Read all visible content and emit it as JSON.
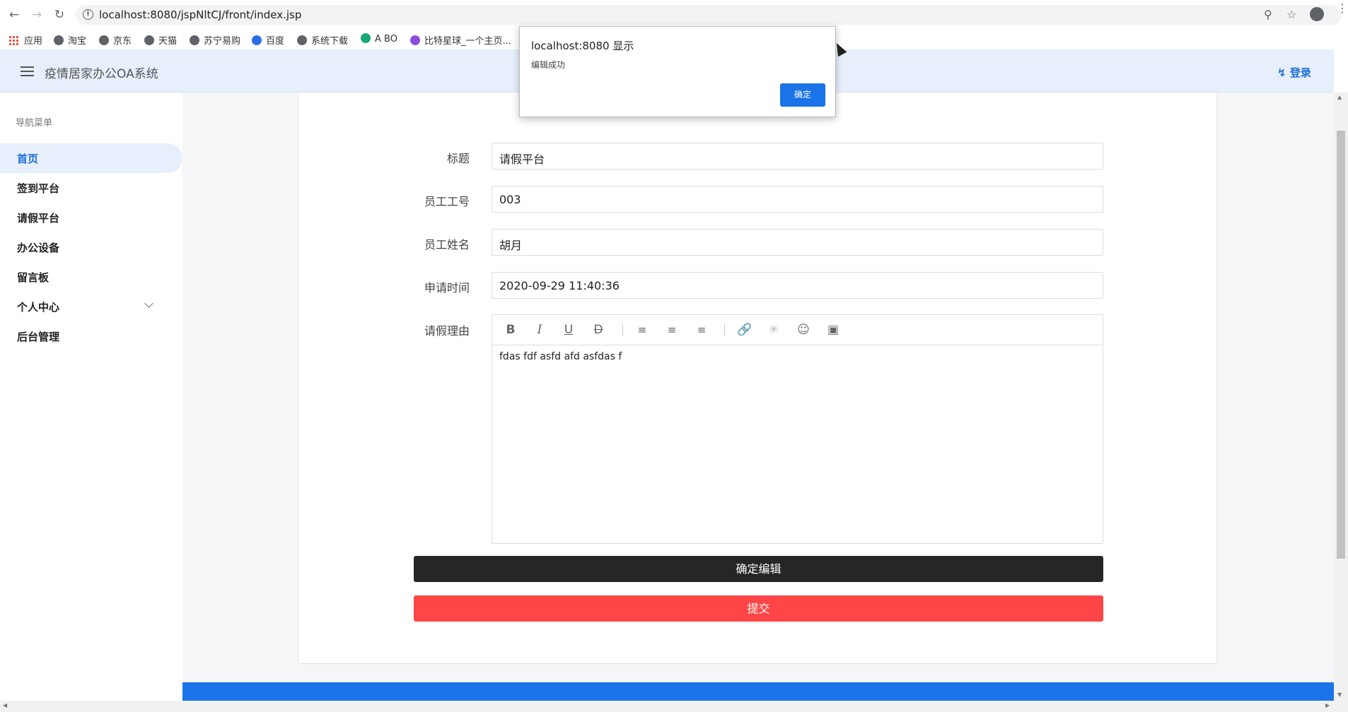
{
  "browser": {
    "url": "localhost:8080/jspNltCJ/front/index.jsp",
    "bookmarks": {
      "apps": "应用",
      "b1": "淘宝",
      "b2": "京东",
      "b3": "天猫",
      "b4": "苏宁易购",
      "b5": "百度",
      "b6": "系统下载",
      "b7": "A BO",
      "b8": "比特星球_一个主页..."
    }
  },
  "header": {
    "title": "疫情居家办公OA系统",
    "login": "登录"
  },
  "sidebar": {
    "heading": "导航菜单",
    "items": [
      {
        "label": "首页"
      },
      {
        "label": "签到平台"
      },
      {
        "label": "请假平台"
      },
      {
        "label": "办公设备"
      },
      {
        "label": "留言板"
      },
      {
        "label": "个人中心"
      },
      {
        "label": "后台管理"
      }
    ]
  },
  "form": {
    "fields": [
      {
        "label": "标题",
        "value": "请假平台"
      },
      {
        "label": "员工工号",
        "value": "003"
      },
      {
        "label": "员工姓名",
        "value": "胡月"
      },
      {
        "label": "申请时间",
        "value": "2020-09-29 11:40:36"
      }
    ],
    "reason_label": "请假理由",
    "reason_text": "fdas fdf asfd afd asfdas f",
    "confirm_button": "确定编辑",
    "submit_button": "提交"
  },
  "dialog": {
    "title": "localhost:8080 显示",
    "message": "编辑成功",
    "ok": "确定"
  },
  "colors": {
    "accent": "#1e6fd9",
    "header_bg": "#e6effb",
    "confirm_button": "#262626",
    "submit_button": "#ff4545",
    "footer": "#1a73e8"
  }
}
